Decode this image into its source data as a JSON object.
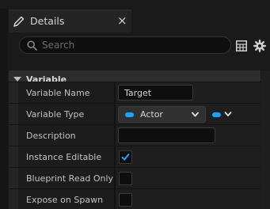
{
  "panel": {
    "title": "Details",
    "close_glyph": "×",
    "title_icon": "pencil-edit-icon"
  },
  "search": {
    "placeholder": "Search",
    "value": ""
  },
  "toolbar": {
    "grid_icon": "property-matrix-icon",
    "settings_icon": "gear-icon"
  },
  "category": {
    "label": "Variable",
    "expanded": true
  },
  "fields": {
    "variable_name": {
      "label": "Variable Name",
      "value": "Target"
    },
    "variable_type": {
      "label": "Variable Type",
      "value": "Actor",
      "type_color": "#1aa3ff"
    },
    "description": {
      "label": "Description",
      "value": ""
    },
    "instance_editable": {
      "label": "Instance Editable",
      "checked": true
    },
    "blueprint_read_only": {
      "label": "Blueprint Read Only",
      "checked": false
    },
    "expose_on_spawn": {
      "label": "Expose on Spawn",
      "checked": false
    }
  },
  "colors": {
    "accent": "#1aa3ff",
    "background": "#1a1a1a",
    "category_bar": "#2d2d2d"
  }
}
